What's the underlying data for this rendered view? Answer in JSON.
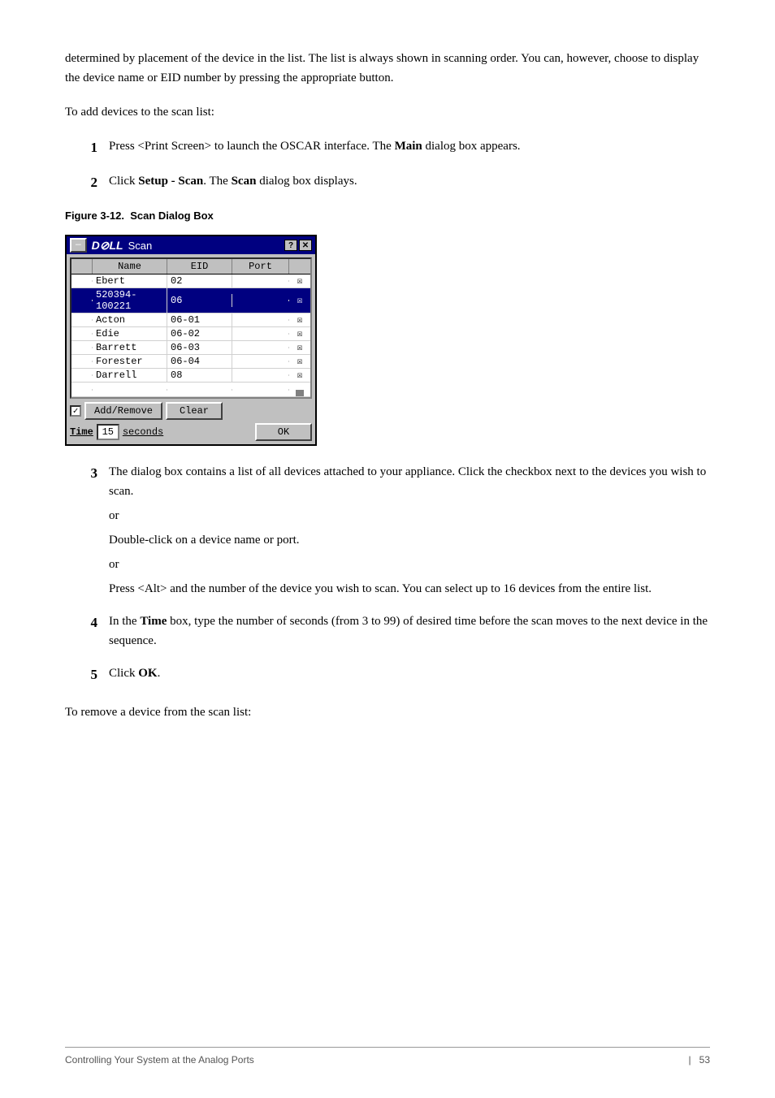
{
  "page": {
    "intro1": "determined by placement of the device in the list. The list is always shown in scanning order. You can, however, choose to display the device name or EID number by pressing the appropriate button.",
    "intro2": "To add devices to the scan list:",
    "steps": [
      {
        "num": "1",
        "text": "Press <Print Screen> to launch the OSCAR interface. The ",
        "bold1": "Main",
        "text2": " dialog box appears."
      },
      {
        "num": "2",
        "text": "Click ",
        "bold1": "Setup - Scan",
        "text2": ". The ",
        "bold2": "Scan",
        "text3": " dialog box displays."
      }
    ],
    "figure_label": "Figure 3-12.",
    "figure_title": "Scan Dialog Box",
    "dialog": {
      "logo": "D⊘LL",
      "title": "Scan",
      "help_btn": "?",
      "close_btn": "✕",
      "minimize_btn": "—",
      "col_name": "Name",
      "col_eid": "EID",
      "col_port": "Port",
      "rows": [
        {
          "name": "Ebert",
          "eid": "02",
          "checked": true,
          "highlighted": false
        },
        {
          "name": "520394-100221",
          "eid": "06",
          "checked": true,
          "highlighted": true
        },
        {
          "name": "Acton",
          "eid": "06-01",
          "checked": true,
          "highlighted": false
        },
        {
          "name": "Edie",
          "eid": "06-02",
          "checked": true,
          "highlighted": false
        },
        {
          "name": "Barrett",
          "eid": "06-03",
          "checked": true,
          "highlighted": false
        },
        {
          "name": "Forester",
          "eid": "06-04",
          "checked": true,
          "highlighted": false
        },
        {
          "name": "Darrell",
          "eid": "08",
          "checked": true,
          "highlighted": false
        }
      ],
      "add_remove_btn": "Add/Remove",
      "clear_btn": "Clear",
      "time_label": "Time",
      "time_value": "15",
      "seconds_label": "seconds",
      "ok_btn": "OK"
    },
    "step3": {
      "num": "3",
      "text": "The dialog box contains a list of all devices attached to your appliance. Click the checkbox next to the devices you wish to scan.",
      "or1": "or",
      "sub1": "Double-click on a device name or port.",
      "or2": "or",
      "sub2": "Press <Alt> and the number of the device you wish to scan. You can select up to 16 devices from the entire list."
    },
    "step4": {
      "num": "4",
      "text": "In the ",
      "bold": "Time",
      "text2": " box, type the number of seconds (from 3 to 99) of desired time before the scan moves to the next device in the sequence."
    },
    "step5": {
      "num": "5",
      "text": "Click ",
      "bold": "OK",
      "text2": "."
    },
    "outro": "To remove a device from the scan list:",
    "footer": {
      "left": "Controlling Your System at the Analog Ports",
      "sep": "|",
      "page": "53"
    }
  }
}
